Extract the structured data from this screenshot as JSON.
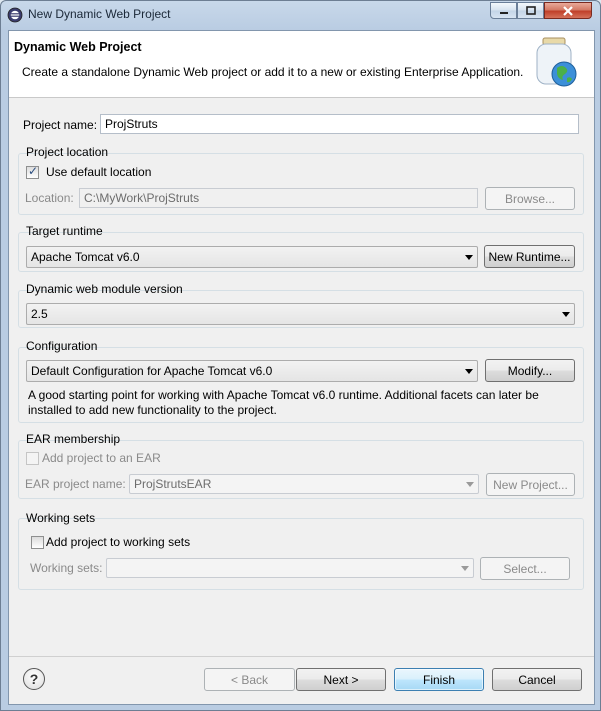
{
  "window": {
    "title": "New Dynamic Web Project"
  },
  "banner": {
    "title": "Dynamic Web Project",
    "description": "Create a standalone Dynamic Web project or add it to a new or existing Enterprise Application."
  },
  "project_name": {
    "label": "Project name:",
    "value": "ProjStruts"
  },
  "project_location": {
    "group_label": "Project location",
    "use_default_label": "Use default location",
    "use_default_checked": true,
    "location_label": "Location:",
    "location_value": "C:\\MyWork\\ProjStruts",
    "browse_label": "Browse..."
  },
  "target_runtime": {
    "group_label": "Target runtime",
    "selected": "Apache Tomcat v6.0",
    "new_runtime_label": "New Runtime..."
  },
  "module_version": {
    "group_label": "Dynamic web module version",
    "selected": "2.5"
  },
  "configuration": {
    "group_label": "Configuration",
    "selected": "Default Configuration for Apache Tomcat v6.0",
    "modify_label": "Modify...",
    "help_line1": "A good starting point for working with Apache Tomcat v6.0 runtime. Additional facets can later be",
    "help_line2": "installed to add new functionality to the project."
  },
  "ear_membership": {
    "group_label": "EAR membership",
    "add_label": "Add project to an EAR",
    "add_checked": false,
    "ear_project_label": "EAR project name:",
    "ear_project_value": "ProjStrutsEAR",
    "new_project_label": "New Project..."
  },
  "working_sets": {
    "group_label": "Working sets",
    "add_label": "Add project to working sets",
    "add_checked": false,
    "working_sets_label": "Working sets:",
    "working_sets_value": "",
    "select_label": "Select..."
  },
  "footer": {
    "help_icon": "question-mark",
    "back_label": "< Back",
    "next_label": "Next >",
    "finish_label": "Finish",
    "cancel_label": "Cancel"
  }
}
